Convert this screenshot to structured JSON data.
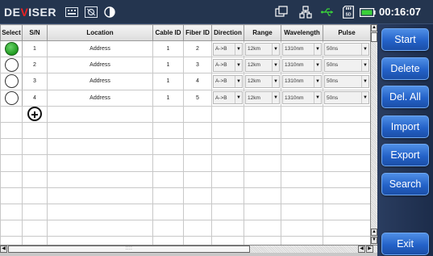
{
  "topbar": {
    "logo_prefix": "DE",
    "logo_accent": "V",
    "logo_suffix": "ISER",
    "icons": [
      "keyboard-icon",
      "screenshot-icon",
      "contrast-icon",
      "windows-icon",
      "network-icon",
      "usb-icon",
      "sd-card-icon",
      "battery-icon"
    ],
    "time": "00:16:07",
    "battery_color": "#3ad13a"
  },
  "table": {
    "columns": [
      "Select",
      "S/N",
      "Location",
      "Cable ID",
      "Fiber ID",
      "Direction",
      "Range",
      "Wavelength",
      "Pulse"
    ],
    "rows": [
      {
        "selected": true,
        "sn": "1",
        "location": "Address",
        "cable_id": "1",
        "fiber_id": "2",
        "direction": "A->B",
        "range": "12km",
        "wavelength": "1310nm",
        "pulse": "50ns"
      },
      {
        "selected": false,
        "sn": "2",
        "location": "Address",
        "cable_id": "1",
        "fiber_id": "3",
        "direction": "A->B",
        "range": "12km",
        "wavelength": "1310nm",
        "pulse": "50ns"
      },
      {
        "selected": false,
        "sn": "3",
        "location": "Address",
        "cable_id": "1",
        "fiber_id": "4",
        "direction": "A->B",
        "range": "12km",
        "wavelength": "1310nm",
        "pulse": "50ns"
      },
      {
        "selected": false,
        "sn": "4",
        "location": "Address",
        "cable_id": "1",
        "fiber_id": "5",
        "direction": "A->B",
        "range": "12km",
        "wavelength": "1310nm",
        "pulse": "50ns"
      }
    ],
    "empty_row_count": 8
  },
  "sidebar": {
    "buttons": [
      "Start",
      "Delete",
      "Del. All",
      "Import",
      "Export",
      "Search"
    ],
    "exit": "Exit"
  },
  "scrollbar": {
    "grip": "::::"
  }
}
